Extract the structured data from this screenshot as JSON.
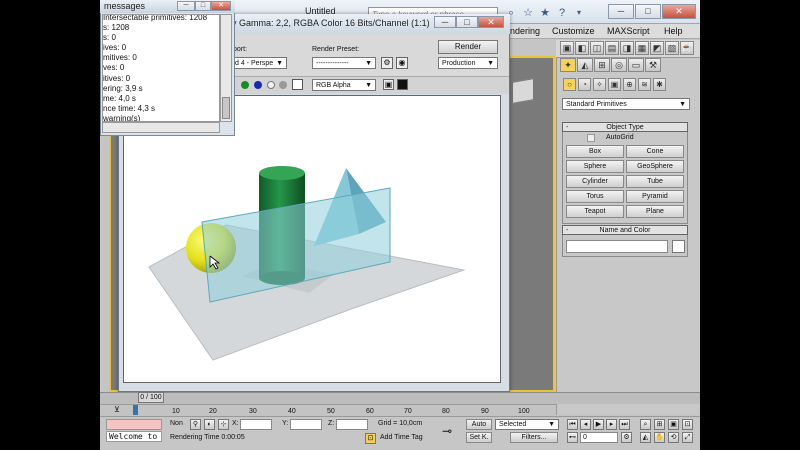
{
  "app": {
    "title": "Untitled",
    "search_placeholder": "Type a keyword or phrase"
  },
  "menu": [
    "ndering",
    "Customize",
    "MAXScript",
    "Help"
  ],
  "toolbar_icons": [
    "binoculars-icon",
    "star-icon",
    "help-icon"
  ],
  "messages_window": {
    "title": "messages",
    "lines": [
      "Intersectable primitives: 1208",
      "s: 1208",
      "s: 0",
      "ives: 0",
      "mitives: 0",
      "ves: 0",
      "itives: 0",
      "ering: 3,9 s",
      "me: 4,0 s",
      "nce time: 4,3 s",
      "warning(s)",
      "========================"
    ]
  },
  "render_frame": {
    "title": "y Gamma: 2,2, RGBA Color 16 Bits/Channel (1:1)",
    "viewport_label": "port:",
    "viewport_value": "d 4 - Perspe",
    "preset_label": "Render Preset:",
    "preset_value": "--------------",
    "render_button": "Render",
    "production_value": "Production",
    "channel_value": "RGB Alpha"
  },
  "command_panel": {
    "category_value": "Standard Primitives",
    "object_type_title": "Object Type",
    "autogrid_label": "AutoGrid",
    "primitives": [
      "Box",
      "Cone",
      "Sphere",
      "GeoSphere",
      "Cylinder",
      "Tube",
      "Torus",
      "Pyramid",
      "Teapot",
      "Plane"
    ],
    "name_color_title": "Name and Color"
  },
  "timeline": {
    "slider_label": "0 / 100",
    "ticks": [
      "10",
      "20",
      "30",
      "40",
      "50",
      "60",
      "70",
      "80",
      "90",
      "100"
    ]
  },
  "status": {
    "welcome": "Welcome to",
    "selection_value": "Non",
    "rendering_time": "Rendering Time  0:00:05",
    "x_label": "X:",
    "y_label": "Y:",
    "z_label": "Z:",
    "grid": "Grid = 10,0cm",
    "add_time_tag": "Add Time Tag",
    "auto_label": "Auto",
    "setk_label": "Set K.",
    "selected_value": "Selected",
    "filters_label": "Filters...",
    "frame_value": "0"
  },
  "colors": {
    "viewport_border": "#e7c53a",
    "sphere": "#e6e21f",
    "cylinder": "#1f7a3a",
    "glass": "#8fd0dc",
    "ground": "#d4d8da"
  }
}
